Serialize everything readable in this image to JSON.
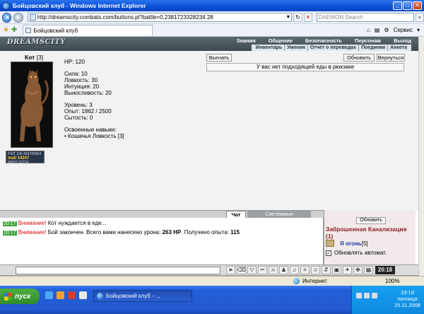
{
  "window": {
    "title": "Бойцовский клуб - Windows Internet Explorer",
    "btn_min": "_",
    "btn_max": "□",
    "btn_close": "✕"
  },
  "address": {
    "back": "◄",
    "forward": "►",
    "url": "http://dreamscity.combats.com/buttons.pl?battle=0.2381723328234 28",
    "dropdown": "▼",
    "refresh": "↻",
    "stop": "✕",
    "search_placeholder": "DAEMON Search"
  },
  "tabs": {
    "active_tab": "Бойцовский клуб",
    "service": "Сервис"
  },
  "game": {
    "logo": "DREAMSCITY",
    "menu_top": [
      "Знания",
      "Общение",
      "Безопасность",
      "Персонаж",
      "Выход"
    ],
    "menu_bottom": [
      "Инвентарь",
      "Умения",
      "Отчет о переводах",
      "Поединки",
      "Анкета"
    ]
  },
  "character": {
    "name": "Кот",
    "level": "[3]",
    "hp": "HP: 120",
    "strength": "Сила: 10",
    "agility": "Ловкость: 30",
    "intuition": "Интуиция: 20",
    "endurance": "Выносливость: 20",
    "level_line": "Уровень: 3",
    "experience": "Опыт: 1862 / 2500",
    "satiety": "Сытость: 0",
    "skills_title": "Освоенные навыки:",
    "skill_1": "• Кошачья Ловкость [3]",
    "badge_line1": "PSIT 100 424720564",
    "badge_line2": "mail 14247",
    "badge_line3": "89007   03774"
  },
  "actions": {
    "kick_out": "Выгнать",
    "refresh": "Обновить",
    "return": "Вернуться",
    "message": "У вас нет подходящей еды в рюкзаке"
  },
  "chat": {
    "tab_chat": "Чат",
    "tab_system": "Системные сообщения",
    "lines": [
      {
        "time": "20:17",
        "warn": "Внимание!",
        "text": "Кот нуждается в еде..."
      },
      {
        "time": "20:17",
        "warn": "Внимание!",
        "text_pre": "Бой закончен. Всего вами нанесено урона:",
        "damage": "263 HP",
        "text_mid": ". Получено опыта:",
        "exp": "115"
      }
    ]
  },
  "side": {
    "refresh": "Обновить",
    "location": "Заброшенная Канализация (1)",
    "me": "Я огонь",
    "me_level": "[5]",
    "auto_check": "✓",
    "auto_refresh": "Обновлять автомат."
  },
  "toolbar": {
    "clock": "20:18"
  },
  "statusbar": {
    "zone": "Интернет",
    "zoom": "100%"
  },
  "taskbar": {
    "start": "пуск",
    "task_title": "Бойцовский клуб - ...",
    "time": "19:19",
    "day": "пятница",
    "date": "25.11.2008"
  }
}
